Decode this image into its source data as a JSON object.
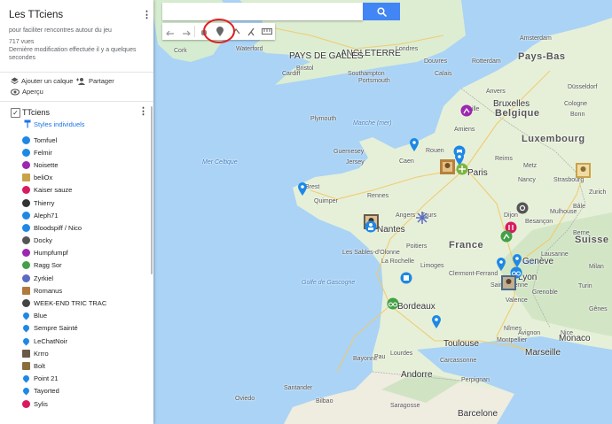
{
  "panel": {
    "title": "Les TTciens",
    "subtitle": "pour faciliter rencontres autour du jeu",
    "views": "717 vues",
    "modified": "Dernière modification effectuée il y a quelques secondes",
    "add_layer": "Ajouter un calque",
    "share": "Partager",
    "preview": "Aperçu",
    "layer_name": "TTciens",
    "styles_label": "Styles individuels"
  },
  "layer_items": [
    {
      "label": "Tomfuel",
      "icon": "person-icon",
      "color": "#1e88e5",
      "shape": "circle"
    },
    {
      "label": "Felmir",
      "icon": "rocket-icon",
      "color": "#1e88e5",
      "shape": "circle"
    },
    {
      "label": "Noisette",
      "icon": "climbing-icon",
      "color": "#9c27b0",
      "shape": "circle"
    },
    {
      "label": "beliOx",
      "icon": "avatar-icon",
      "color": "#c9a24a",
      "shape": "img"
    },
    {
      "label": "Kaiser sauze",
      "icon": "pitchfork-icon",
      "color": "#d81b60",
      "shape": "circle"
    },
    {
      "label": "Thierry",
      "icon": "ladder-icon",
      "color": "#333333",
      "shape": "circle"
    },
    {
      "label": "Aleph71",
      "icon": "person-icon",
      "color": "#1e88e5",
      "shape": "circle"
    },
    {
      "label": "Bloodspiff / Nico",
      "icon": "dots-icon",
      "color": "#1e88e5",
      "shape": "circle"
    },
    {
      "label": "Docky",
      "icon": "peace-icon",
      "color": "#555555",
      "shape": "circle"
    },
    {
      "label": "Humpfumpf",
      "icon": "pitchfork-icon",
      "color": "#9c27b0",
      "shape": "circle"
    },
    {
      "label": "Ragg Sor",
      "icon": "climbing-icon",
      "color": "#43a047",
      "shape": "circle"
    },
    {
      "label": "Zyrkiel",
      "icon": "snowflake-icon",
      "color": "#5c6bc0",
      "shape": "circle"
    },
    {
      "label": "Romanus",
      "icon": "avatar-icon",
      "color": "#b07a3c",
      "shape": "img"
    },
    {
      "label": "WEEK-END TRIC TRAC",
      "icon": "settings-icon",
      "color": "#444444",
      "shape": "circle"
    },
    {
      "label": "Blue",
      "icon": "pin-icon",
      "color": "#1e88e5",
      "shape": "pin"
    },
    {
      "label": "Sempre Sainté",
      "icon": "pin-icon",
      "color": "#1e88e5",
      "shape": "pin"
    },
    {
      "label": "LeChatNoir",
      "icon": "pin-icon",
      "color": "#1e88e5",
      "shape": "pin"
    },
    {
      "label": "Krrro",
      "icon": "avatar-icon",
      "color": "#6b5a4a",
      "shape": "img"
    },
    {
      "label": "Bolt",
      "icon": "avatar-icon",
      "color": "#8a6d3b",
      "shape": "img"
    },
    {
      "label": "Point 21",
      "icon": "pin-icon",
      "color": "#1e88e5",
      "shape": "pin"
    },
    {
      "label": "Tayorted",
      "icon": "pin-icon",
      "color": "#1e88e5",
      "shape": "pin"
    },
    {
      "label": "Sylis",
      "icon": "pitchfork-icon",
      "color": "#d81b60",
      "shape": "circle"
    }
  ],
  "map_labels": {
    "countries": [
      "Pays-Bas",
      "Belgique",
      "Luxembourg",
      "France",
      "Suisse",
      "Monaco",
      "Andorre",
      "ANGLETERRE",
      "PAYS DE GALLES"
    ],
    "cities": [
      "Rotterdam",
      "Amsterdam",
      "Anvers",
      "Bruxelles",
      "Düsseldorf",
      "Cologne",
      "Bonn",
      "Strasbourg",
      "Genève",
      "Lyon",
      "Grenoble",
      "Clermont-Ferrand",
      "Bordeaux",
      "Toulouse",
      "Montpellier",
      "Marseille",
      "Nice",
      "Nantes",
      "Angers",
      "Tours",
      "Rennes",
      "Brest",
      "Quimper",
      "Caen",
      "Rouen",
      "Amiens",
      "Lille",
      "Reims",
      "Paris",
      "Dijon",
      "Limoges",
      "Poitiers",
      "La Rochelle",
      "Les Sables-d'Olonne",
      "Bayonne",
      "Pau",
      "Bilbao",
      "Saragosse",
      "Barcelone",
      "Oviedo",
      "Santander",
      "Lourdes",
      "Carcassonne",
      "Perpignan",
      "Nîmes",
      "Avignon",
      "Turin",
      "Milan",
      "Gênes",
      "Bristol",
      "Cardiff",
      "Plymouth",
      "Portsmouth",
      "Southampton",
      "Londres",
      "Douvres",
      "Guernesey",
      "Jersey",
      "Cork",
      "Waterford",
      "Calais",
      "Metz",
      "Nancy",
      "Besançon",
      "Mulhouse",
      "Bâle",
      "Zurich",
      "Berne",
      "Lausanne",
      "Saint-Étienne",
      "Valence",
      "Nice"
    ],
    "seas": [
      "Mer Celtique",
      "Manche (mer)",
      "Golfe de Gascogne"
    ]
  },
  "search": {
    "placeholder": ""
  }
}
